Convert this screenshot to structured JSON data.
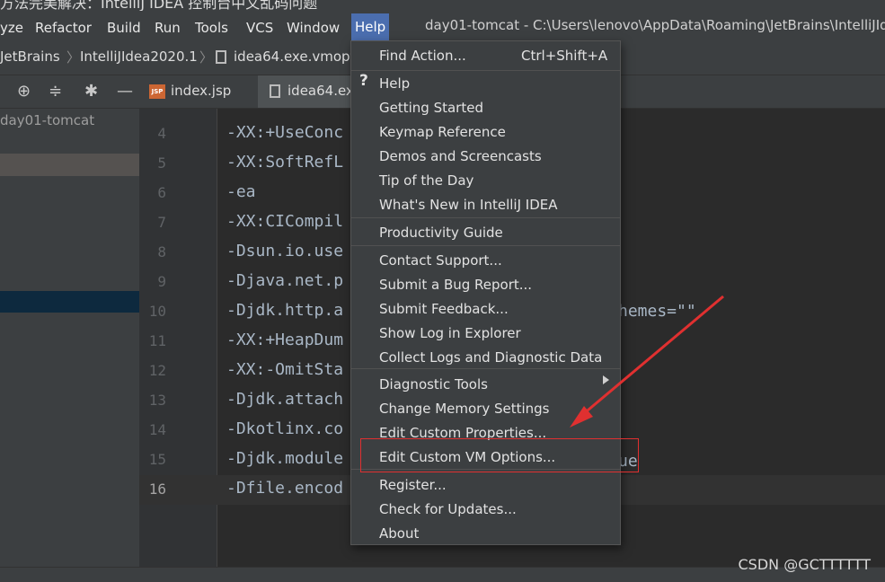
{
  "blog_title": "方法完美解决：IntelliJ IDEA 控制台中文乱码问题",
  "menubar": {
    "items": [
      "yze",
      "Refactor",
      "Build",
      "Run",
      "Tools",
      "VCS",
      "Window",
      "Help"
    ],
    "window_title": "day01-tomcat - C:\\Users\\lenovo\\AppData\\Roaming\\JetBrains\\IntelliJIde"
  },
  "breadcrumb": [
    "JetBrains",
    "IntelliJIdea2020.1",
    "idea64.exe.vmopt"
  ],
  "toolbar": {
    "icons": [
      "target-icon",
      "collapse-icon",
      "gear-icon",
      "minimize-icon"
    ],
    "tabs": [
      {
        "label": "index.jsp",
        "icon": "jsp-icon",
        "icon_text": "JSP"
      },
      {
        "label": "idea64.ex",
        "icon": "file-icon"
      }
    ]
  },
  "project": {
    "label": "day01-tomcat"
  },
  "editor": {
    "lines": [
      {
        "num": "4",
        "code": "-XX:+UseConc"
      },
      {
        "num": "5",
        "code": "-XX:SoftRefL"
      },
      {
        "num": "6",
        "code": "-ea"
      },
      {
        "num": "7",
        "code": "-XX:CICompil"
      },
      {
        "num": "8",
        "code": "-Dsun.io.use"
      },
      {
        "num": "9",
        "code": "-Djava.net.p"
      },
      {
        "num": "10",
        "code": "-Djdk.http.a"
      },
      {
        "num": "11",
        "code": "-XX:+HeapDum"
      },
      {
        "num": "12",
        "code": "-XX:-OmitSta"
      },
      {
        "num": "13",
        "code": "-Djdk.attach"
      },
      {
        "num": "14",
        "code": "-Dkotlinx.co"
      },
      {
        "num": "15",
        "code": "-Djdk.module"
      },
      {
        "num": "16",
        "code": "-Dfile.encod"
      }
    ],
    "fragment_schemes": "hemes=\"\"",
    "fragment_ue": "ue",
    "current_line": "16"
  },
  "help_menu": {
    "find_action": {
      "label": "Find Action...",
      "shortcut": "Ctrl+Shift+A"
    },
    "items": [
      "Help",
      "Getting Started",
      "Keymap Reference",
      "Demos and Screencasts",
      "Tip of the Day",
      "What's New in IntelliJ IDEA",
      "Productivity Guide",
      "Contact Support...",
      "Submit a Bug Report...",
      "Submit Feedback...",
      "Show Log in Explorer",
      "Collect Logs and Diagnostic Data",
      "Diagnostic Tools",
      "Change Memory Settings",
      "Edit Custom Properties...",
      "Edit Custom VM Options...",
      "Register...",
      "Check for Updates...",
      "About"
    ]
  },
  "annotation": {
    "arrow_color": "#e03030"
  },
  "watermark": "CSDN @GCTTTTTT"
}
